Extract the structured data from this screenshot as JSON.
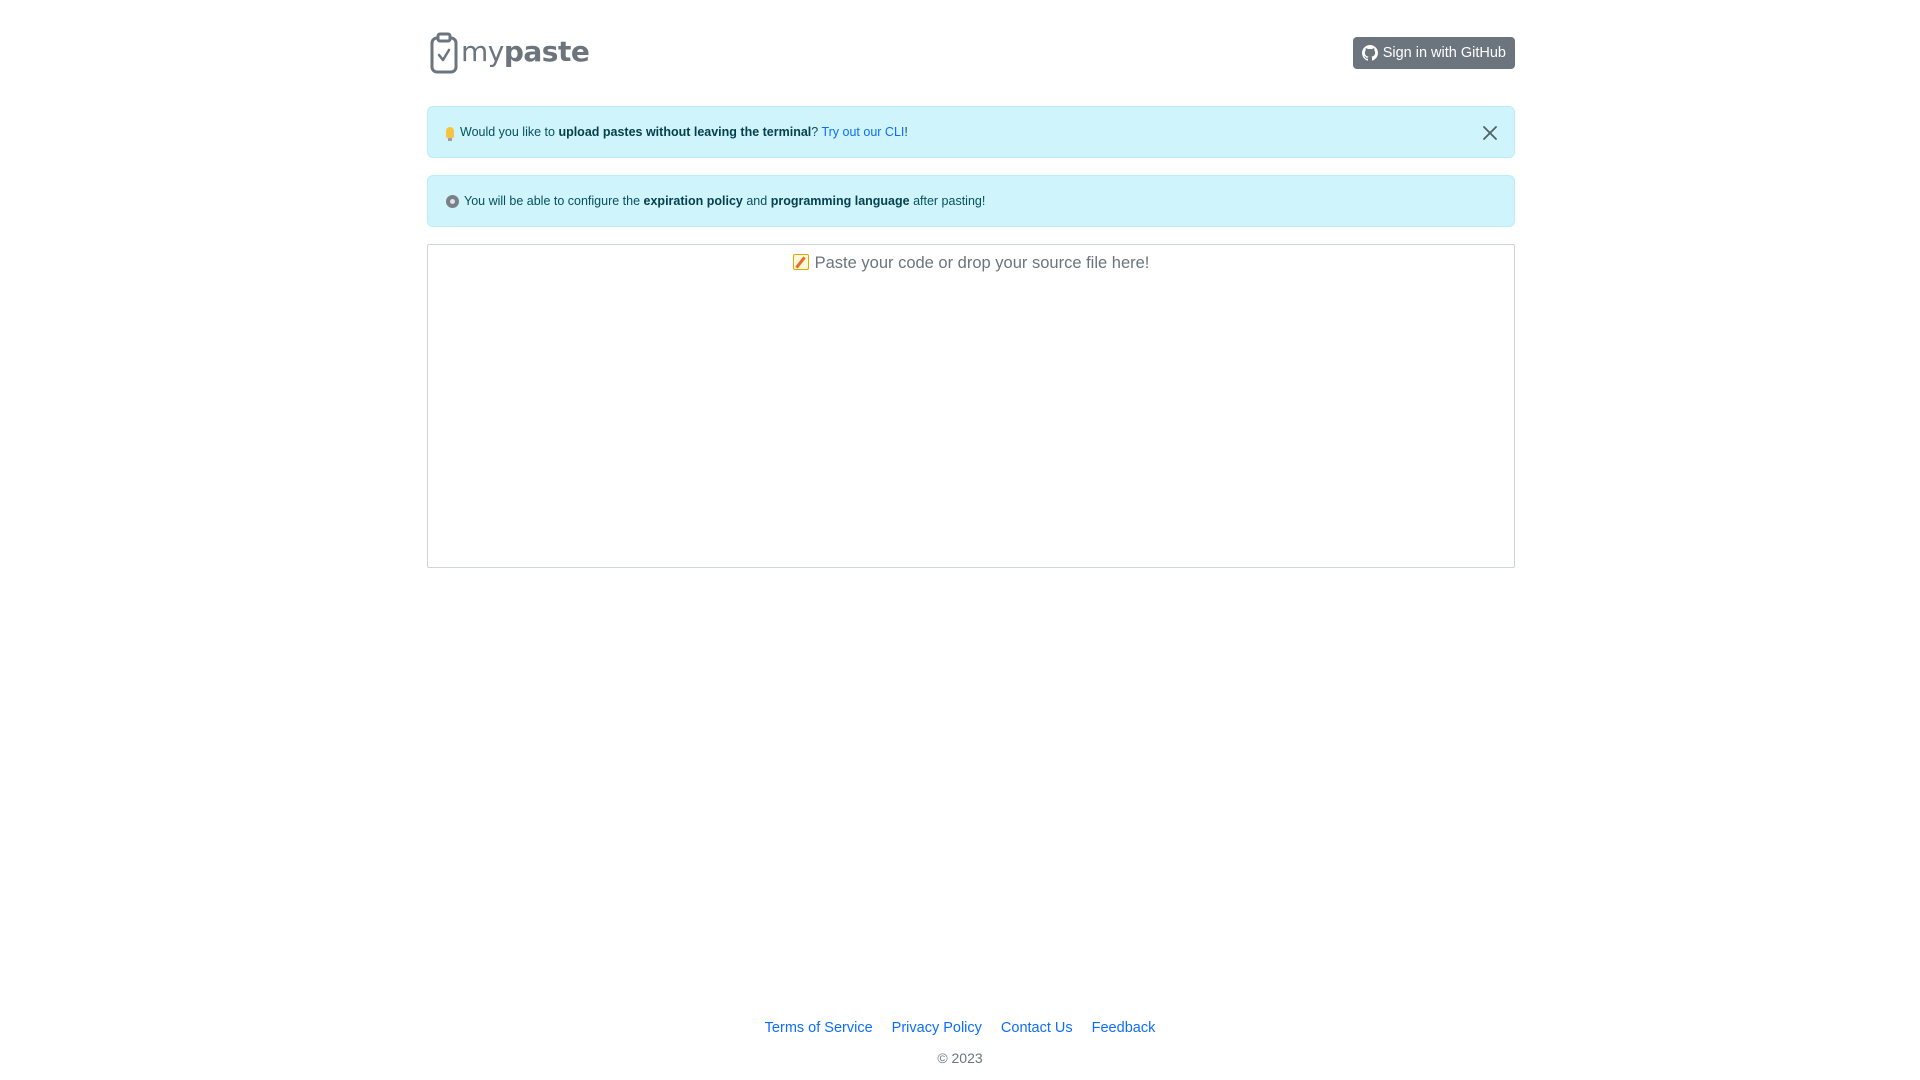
{
  "header": {
    "logo_my": "my",
    "logo_paste": "paste",
    "signin_label": "Sign in with GitHub"
  },
  "alerts": {
    "cli": {
      "text_before": "Would you like to ",
      "bold": "upload pastes without leaving the terminal",
      "text_mid": "? ",
      "link": "Try out our CLI",
      "text_after": "!"
    },
    "config": {
      "text_before": "You will be able to configure the ",
      "bold1": "expiration policy",
      "text_mid": " and ",
      "bold2": "programming language",
      "text_after": " after pasting!"
    }
  },
  "editor": {
    "placeholder": "Paste your code or drop your source file here!"
  },
  "footer": {
    "links": [
      "Terms of Service",
      "Privacy Policy",
      "Contact Us",
      "Feedback"
    ],
    "copyright": "© 2023"
  },
  "colors": {
    "brand_gray": "#6c757d",
    "alert_bg": "#cff4fc",
    "alert_text": "#055160",
    "link": "#0d6efd"
  }
}
